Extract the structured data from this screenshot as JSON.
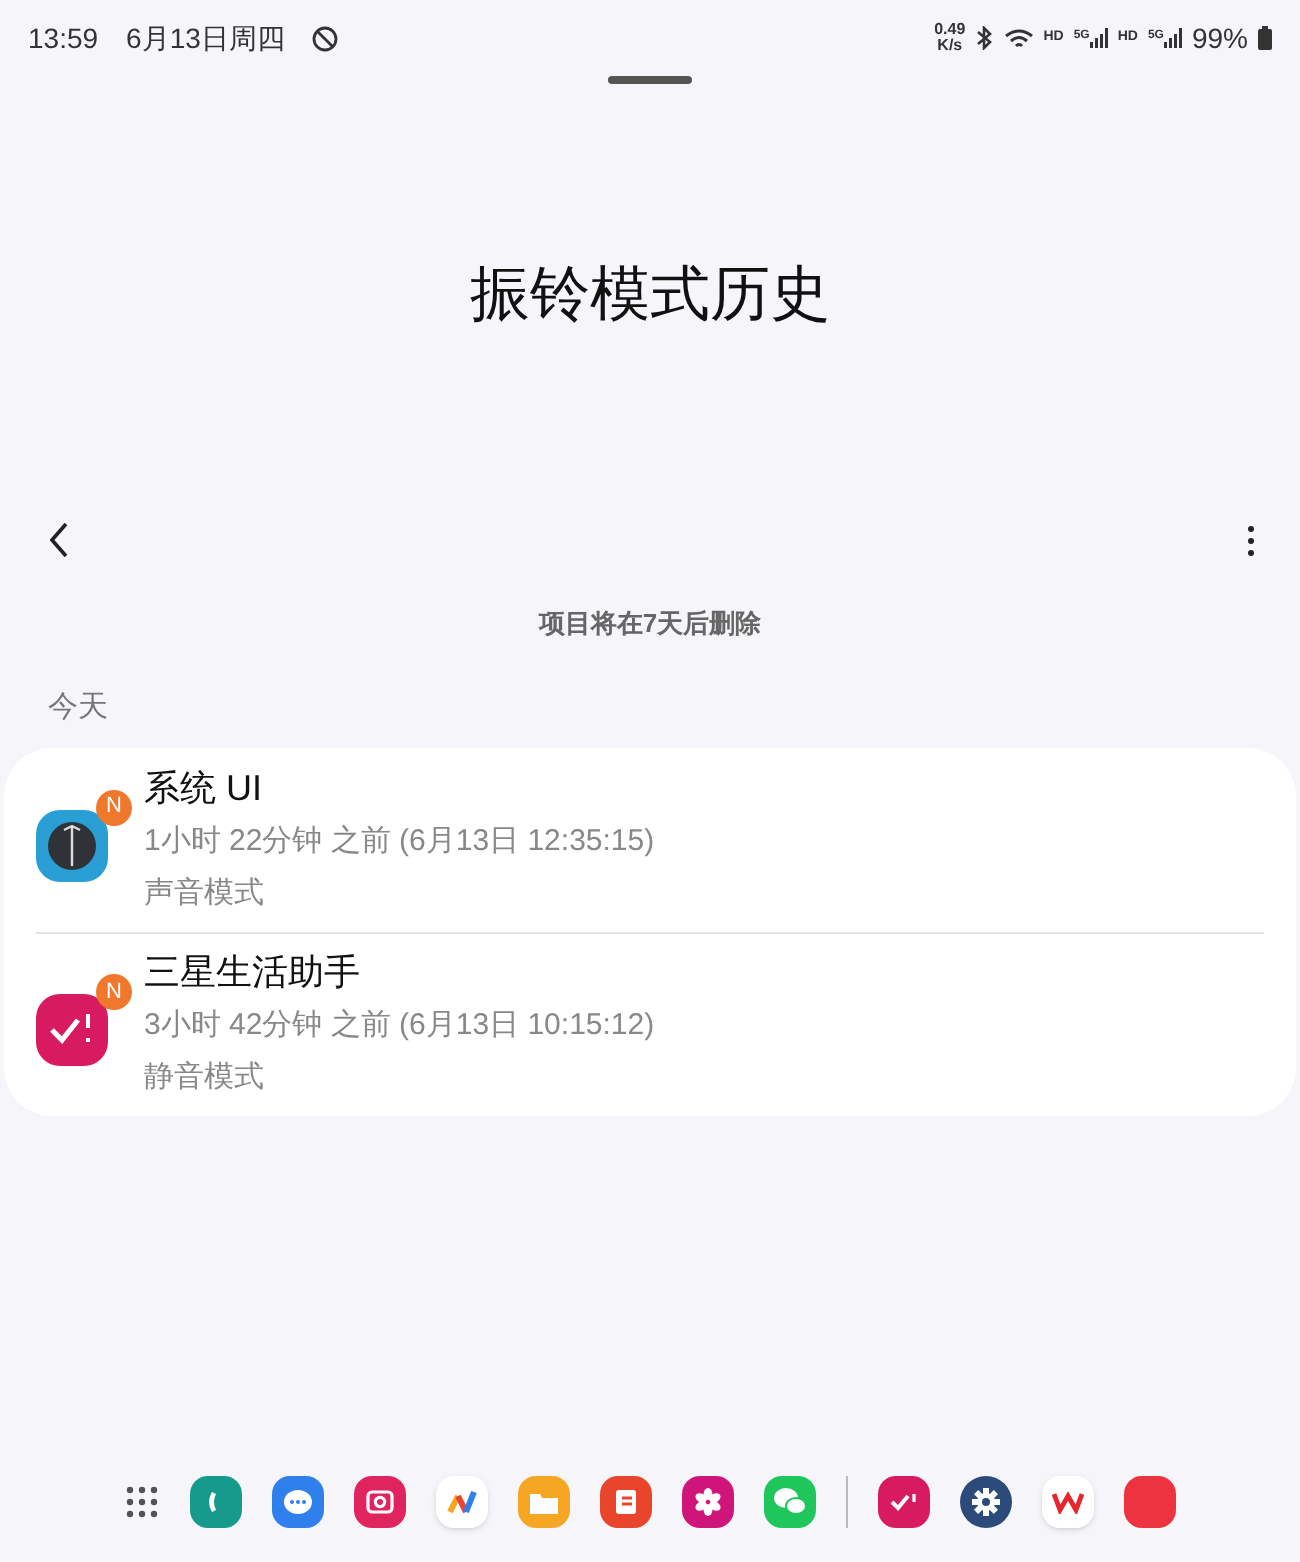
{
  "status_bar": {
    "time": "13:59",
    "date": "6月13日周四",
    "speed": [
      "0.49",
      "K/s"
    ],
    "network_labels": [
      "HD",
      "5G",
      "HD",
      "5G"
    ],
    "battery": "99%"
  },
  "header": {
    "title": "振铃模式历史"
  },
  "notice": "项目将在7天后删除",
  "section": "今天",
  "items": [
    {
      "kind": "system",
      "name": "系统 UI",
      "badge": "N",
      "time": "1小时 22分钟 之前 (6月13日 12:35:15)",
      "mode": "声音模式"
    },
    {
      "kind": "assistant",
      "name": "三星生活助手",
      "badge": "N",
      "time": "3小时 42分钟 之前 (6月13日 10:15:12)",
      "mode": "静音模式"
    }
  ],
  "dock": [
    {
      "kind": "apps"
    },
    {
      "kind": "phone",
      "color": "#169a8c"
    },
    {
      "kind": "chat",
      "color": "#2f80ed"
    },
    {
      "kind": "camera",
      "color": "#e0245e"
    },
    {
      "kind": "logo",
      "color": "#ffffff"
    },
    {
      "kind": "folder",
      "color": "#f5a623"
    },
    {
      "kind": "notes",
      "color": "#e8452c"
    },
    {
      "kind": "flower",
      "color": "#d0157a"
    },
    {
      "kind": "wechat",
      "color": "#1fc65b"
    },
    {
      "kind": "divider"
    },
    {
      "kind": "check",
      "color": "#d81b60"
    },
    {
      "kind": "gear",
      "color": "#2c4a7a"
    },
    {
      "kind": "office",
      "color": "#ffffff"
    },
    {
      "kind": "plain",
      "color": "#ee3340"
    }
  ]
}
